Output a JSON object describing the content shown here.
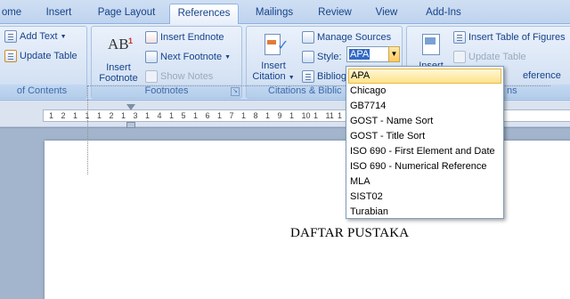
{
  "tabs": [
    {
      "label": "ome",
      "active": false
    },
    {
      "label": "Insert",
      "active": false
    },
    {
      "label": "Page Layout",
      "active": false
    },
    {
      "label": "References",
      "active": true
    },
    {
      "label": "Mailings",
      "active": false
    },
    {
      "label": "Review",
      "active": false
    },
    {
      "label": "View",
      "active": false
    },
    {
      "label": "Add-Ins",
      "active": false
    }
  ],
  "ribbon": {
    "toc_group": {
      "add_text": "Add Text",
      "update_table": "Update Table",
      "label": "of Contents"
    },
    "footnotes_group": {
      "insert_footnote_line1": "Insert",
      "insert_footnote_line2": "Footnote",
      "insert_endnote": "Insert Endnote",
      "next_footnote": "Next Footnote",
      "show_notes": "Show Notes",
      "label": "Footnotes",
      "big_icon_text": "AB"
    },
    "citations_group": {
      "insert_citation_line1": "Insert",
      "insert_citation_line2": "Citation",
      "manage_sources": "Manage Sources",
      "style_label": "Style:",
      "style_value": "APA",
      "bibliography": "Bibliog",
      "label": "Citations & Biblic"
    },
    "captions_group": {
      "insert_caption_line1": "Insert",
      "insert_table_of_figures": "Insert Table of Figures",
      "update_table": "Update Table",
      "cross_reference": "eference",
      "label": "ns"
    }
  },
  "ruler": {
    "numbers": [
      "1",
      "2",
      "1",
      "1",
      "1",
      "2",
      "1",
      "3",
      "1",
      "4",
      "1",
      "5",
      "1",
      "6",
      "1",
      "7",
      "1",
      "8",
      "1",
      "9",
      "1",
      "10",
      "1",
      "11",
      "1",
      "12",
      "1",
      "13"
    ]
  },
  "style_dropdown": {
    "options": [
      "APA",
      "Chicago",
      "GB7714",
      "GOST - Name Sort",
      "GOST - Title Sort",
      "ISO 690 - First Element and Date",
      "ISO 690 - Numerical Reference",
      "MLA",
      "SIST02",
      "Turabian"
    ],
    "selected": "APA"
  },
  "document": {
    "title": "DAFTAR PUSTAKA"
  },
  "colors": {
    "ribbon_text": "#15428b",
    "selection_highlight": "#ffe38a",
    "tab_border": "#8db2e3"
  }
}
